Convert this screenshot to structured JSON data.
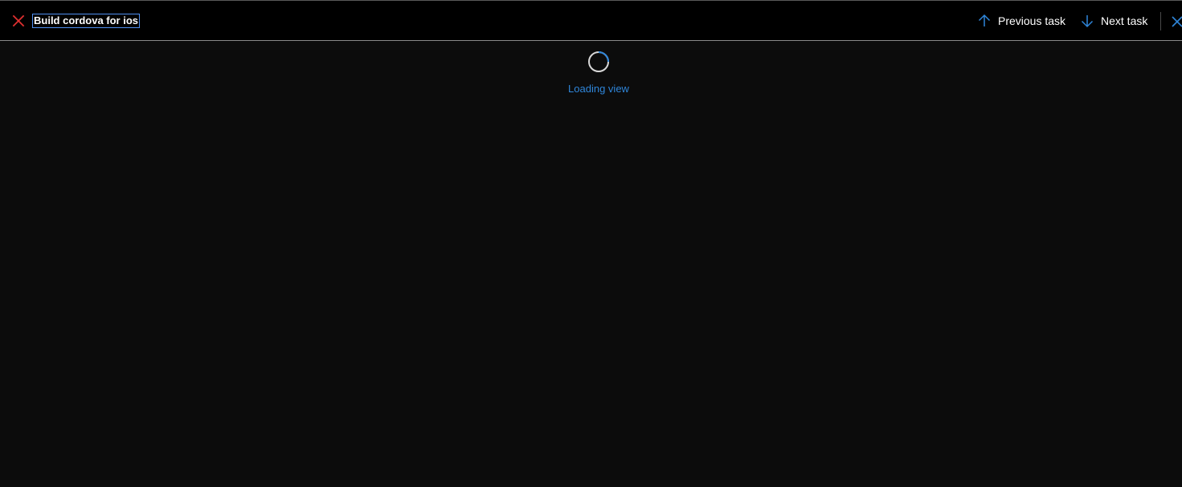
{
  "header": {
    "task_title": "Build cordova for ios",
    "status_icon": "x-mark-icon",
    "status_color": "#e03030",
    "previous_label": "Previous task",
    "next_label": "Next task",
    "previous_icon": "arrow-up-icon",
    "next_icon": "arrow-down-icon",
    "close_icon": "close-icon",
    "accent_color": "#2f86da"
  },
  "main": {
    "loading_text": "Loading view",
    "spinner_icon": "loading-spinner-icon"
  }
}
